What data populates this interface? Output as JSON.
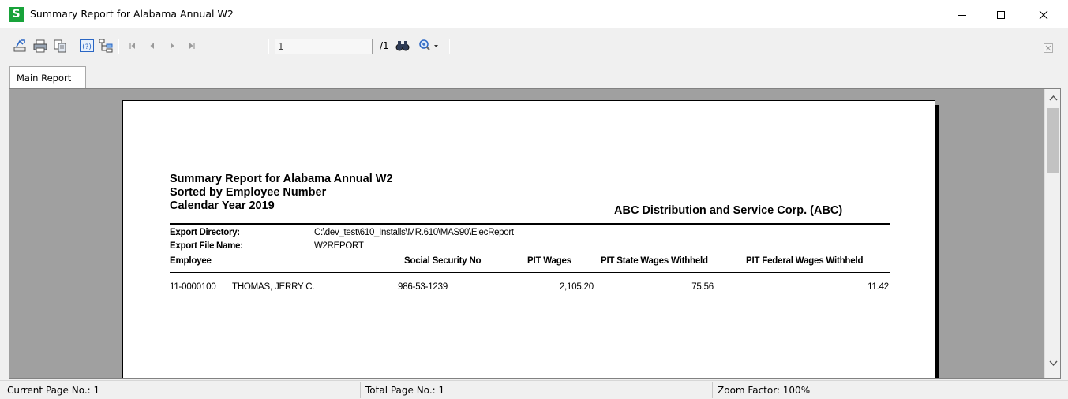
{
  "window": {
    "icon_letter": "S",
    "title": "Summary Report for Alabama Annual W2"
  },
  "toolbar": {
    "page_input_value": "1",
    "page_total": "/1"
  },
  "tabs": [
    {
      "label": "Main Report"
    }
  ],
  "report": {
    "title_line1": "Summary Report for Alabama Annual W2",
    "title_line2": "Sorted by Employee Number",
    "title_line3": "Calendar Year 2019",
    "company": "ABC Distribution and Service Corp. (ABC)",
    "export_directory_label": "Export Directory:",
    "export_directory_value": "C:\\dev_test\\610_Installs\\MR.610\\MAS90\\ElecReport",
    "export_file_label": "Export File Name:",
    "export_file_value": "W2REPORT",
    "columns": {
      "employee": "Employee",
      "ssn": "Social Security No",
      "pit_wages": "PIT Wages",
      "pit_state": "PIT State Wages Withheld",
      "pit_federal": "PIT Federal Wages Withheld"
    },
    "rows": [
      {
        "employee_no": "11-0000100",
        "employee_name": "THOMAS, JERRY C.",
        "ssn": "986-53-1239",
        "pit_wages": "2,105.20",
        "pit_state": "75.56",
        "pit_federal": "11.42"
      }
    ]
  },
  "status": {
    "current_page": "Current Page No.: 1",
    "total_page": "Total Page No.: 1",
    "zoom": "Zoom Factor: 100%"
  },
  "colors": {
    "app_icon": "#18a33a",
    "viewer_bg": "#a0a0a0"
  }
}
